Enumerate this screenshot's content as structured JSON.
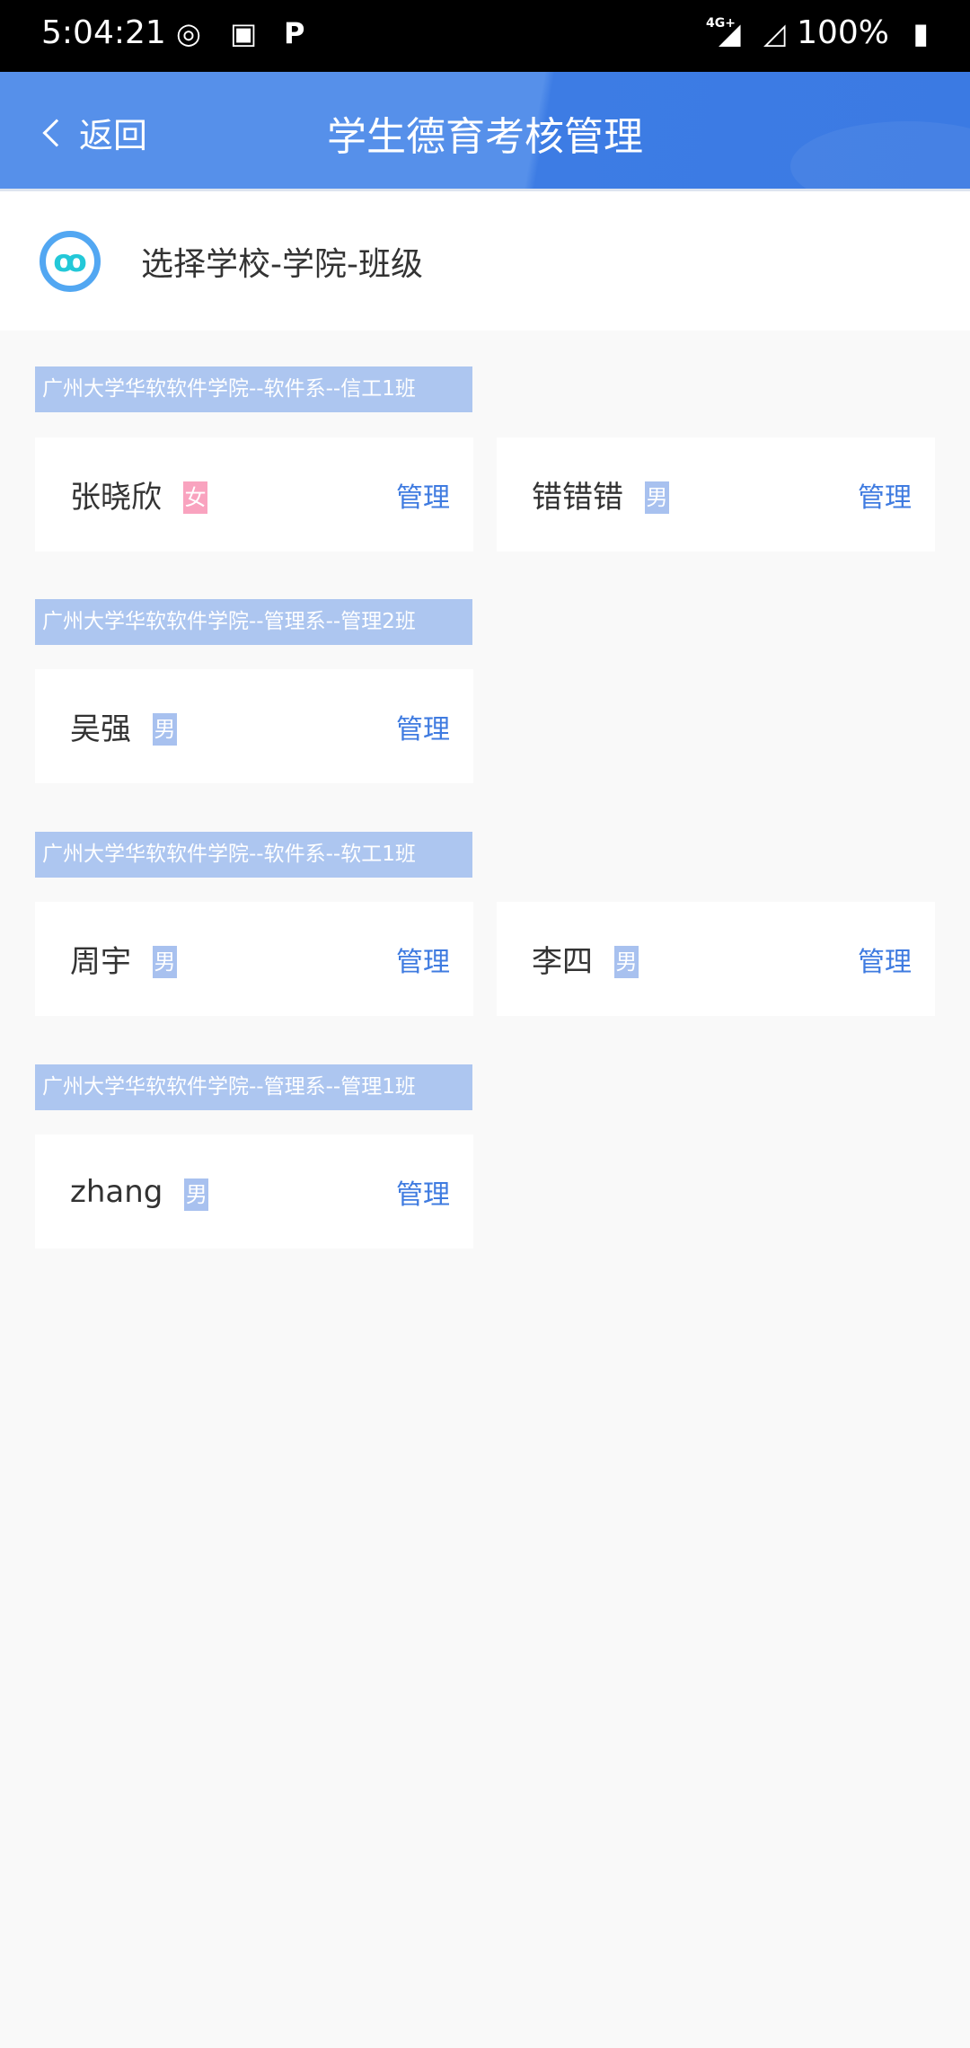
{
  "status_bar": {
    "time": "5:04:21",
    "network": "4G+",
    "battery": "100%"
  },
  "header": {
    "back_label": "返回",
    "title": "学生德育考核管理"
  },
  "selector": {
    "label": "选择学校-学院-班级"
  },
  "colors": {
    "female": "#f9a3bf",
    "male": "#a8c1ef",
    "accent": "#3f7be0"
  },
  "groups": [
    {
      "label": "广州大学华软软件学院--软件系--信工1班",
      "students": [
        {
          "name": "张晓欣",
          "gender": "女",
          "action": "管理"
        },
        {
          "name": "错错错",
          "gender": "男",
          "action": "管理"
        }
      ]
    },
    {
      "label": "广州大学华软软件学院--管理系--管理2班",
      "students": [
        {
          "name": "吴强",
          "gender": "男",
          "action": "管理"
        }
      ]
    },
    {
      "label": "广州大学华软软件学院--软件系--软工1班",
      "students": [
        {
          "name": "周宇",
          "gender": "男",
          "action": "管理"
        },
        {
          "name": "李四",
          "gender": "男",
          "action": "管理"
        }
      ]
    },
    {
      "label": "广州大学华软软件学院--管理系--管理1班",
      "students": [
        {
          "name": "zhang",
          "gender": "男",
          "action": "管理"
        }
      ]
    }
  ]
}
